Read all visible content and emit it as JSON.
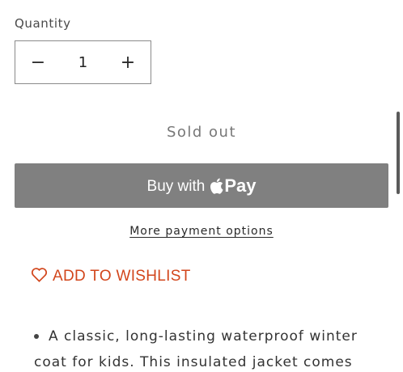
{
  "quantity": {
    "label": "Quantity",
    "value": "1",
    "decrement_symbol": "−",
    "increment_symbol": "+"
  },
  "sold_out_label": "Sold out",
  "apple_pay": {
    "buy_text": "Buy with",
    "pay_text": "Pay",
    "icon": "apple-logo-icon"
  },
  "more_payment_label": "More payment options",
  "wishlist": {
    "label": "ADD TO WISHLIST",
    "icon": "heart-outline-icon",
    "color": "#d2461c"
  },
  "description": {
    "text": "A classic, long-lasting waterproof winter coat for kids. This insulated jacket comes"
  },
  "colors": {
    "apple_pay_bg": "#808080",
    "accent": "#d2461c"
  }
}
